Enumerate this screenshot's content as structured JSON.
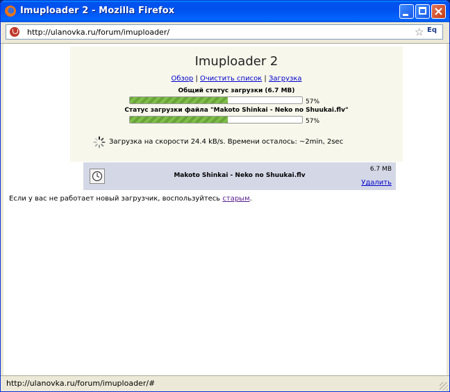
{
  "window": {
    "title": "Imuploader 2 - Mozilla Firefox"
  },
  "navbar": {
    "url": "http://ulanovka.ru/forum/imuploader/",
    "lang_badge": "Eq"
  },
  "uploader": {
    "heading": "Imuploader 2",
    "links": [
      {
        "label": "Обзор"
      },
      {
        "label": "Очистить список"
      },
      {
        "label": "Загрузка"
      }
    ],
    "separator": "|",
    "overall_label": "Общий статус загрузки (6.7 MB)",
    "overall_progress_text": "57%",
    "overall_progress": 0.57,
    "file_label": "Статус загрузки файла \"Makoto Shinkai - Neko no Shuukai.flv\"",
    "file_progress_text": "57%",
    "file_progress": 0.57,
    "speed_text": "Загрузка на скорости 24.4 kB/s. Времени осталось: ~2min, 2sec"
  },
  "file": {
    "name": "Makoto Shinkai - Neko no Shuukai.flv",
    "size": "6.7 MB",
    "delete_label": "Удалить"
  },
  "note": {
    "text": "Если у вас не работает новый загрузчик, воспользуйтесь ",
    "link": "старым",
    "suffix": "."
  },
  "statusbar": {
    "text": "http://ulanovka.ru/forum/imuploader/#"
  },
  "colors": {
    "titlebar": "#0054e3",
    "progress": "#6aa33a",
    "file_row": "#d4d8e6",
    "uploader_bg": "#f7f7ec"
  }
}
